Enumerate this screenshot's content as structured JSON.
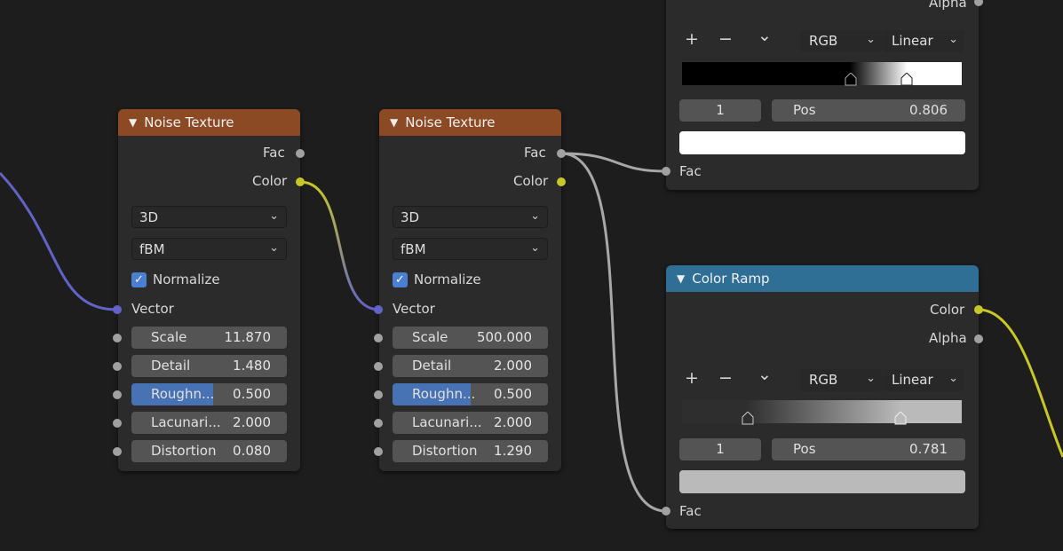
{
  "nodes": {
    "noise1": {
      "title": "Noise Texture",
      "outputs": {
        "fac": "Fac",
        "color": "Color"
      },
      "dimension": "3D",
      "type": "fBM",
      "normalize_label": "Normalize",
      "normalize_checked": true,
      "vector_label": "Vector",
      "fields": [
        {
          "name": "Scale",
          "value": "11.870"
        },
        {
          "name": "Detail",
          "value": "1.480"
        },
        {
          "name": "Roughn...",
          "value": "0.500",
          "fill_fraction": 0.5
        },
        {
          "name": "Lacunari...",
          "value": "2.000"
        },
        {
          "name": "Distortion",
          "value": "0.080"
        }
      ]
    },
    "noise2": {
      "title": "Noise Texture",
      "outputs": {
        "fac": "Fac",
        "color": "Color"
      },
      "dimension": "3D",
      "type": "fBM",
      "normalize_label": "Normalize",
      "normalize_checked": true,
      "vector_label": "Vector",
      "fields": [
        {
          "name": "Scale",
          "value": "500.000"
        },
        {
          "name": "Detail",
          "value": "2.000"
        },
        {
          "name": "Roughn...",
          "value": "0.500",
          "fill_fraction": 0.5
        },
        {
          "name": "Lacunari...",
          "value": "2.000"
        },
        {
          "name": "Distortion",
          "value": "1.290"
        }
      ]
    },
    "ramp_top": {
      "alpha_label": "Alpha",
      "color_mode": "RGB",
      "interpolation": "Linear",
      "active_index": "1",
      "pos_label": "Pos",
      "pos_value": "0.806",
      "active_color": "#ffffff",
      "input_label": "Fac",
      "stops": [
        {
          "pos": 0.6,
          "color": "#000000"
        },
        {
          "pos": 0.806,
          "color": "#ffffff"
        }
      ]
    },
    "ramp_bottom": {
      "title": "Color Ramp",
      "color_label": "Color",
      "alpha_label": "Alpha",
      "color_mode": "RGB",
      "interpolation": "Linear",
      "active_index": "1",
      "pos_label": "Pos",
      "pos_value": "0.781",
      "active_color": "#bababa",
      "input_label": "Fac",
      "stops": [
        {
          "pos": 0.23,
          "color": "#2e2e2e"
        },
        {
          "pos": 0.781,
          "color": "#bababa"
        }
      ]
    }
  },
  "toolbar": {
    "add": "+",
    "remove": "−",
    "menu": "⌄"
  },
  "icons": {
    "collapse": "chevron-down-icon",
    "dropdown": "dropdown-arrow-icon",
    "check": "checkmark-icon"
  },
  "colors": {
    "texture_header": "#8b4a24",
    "converter_header": "#2f6f96",
    "socket_float": "#a1a1a1",
    "socket_color": "#c7c729",
    "socket_vector": "#6363c7"
  }
}
